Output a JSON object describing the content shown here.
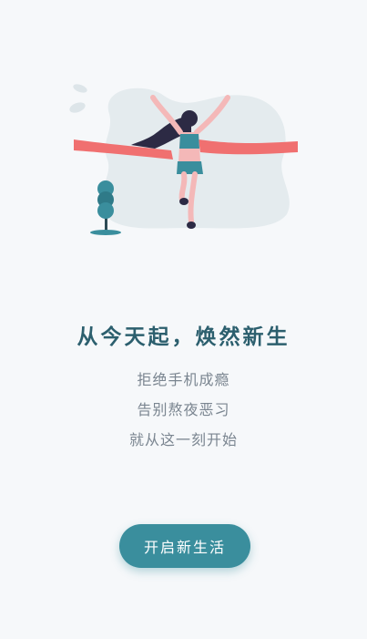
{
  "content": {
    "title": "从今天起，焕然新生",
    "lines": [
      "拒绝手机成瘾",
      "告别熬夜恶习",
      "就从这一刻开始"
    ]
  },
  "actions": {
    "start_label": "开启新生活"
  },
  "colors": {
    "background": "#f6f8fa",
    "accent": "#3a8e9d",
    "title": "#2c5f6e",
    "ribbon": "#f07070"
  },
  "illustration": {
    "icon": "finish-line-runner-illustration"
  }
}
